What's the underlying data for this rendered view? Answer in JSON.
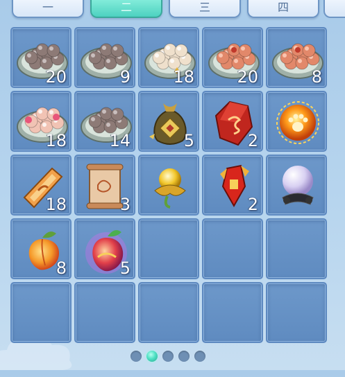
{
  "tabs": [
    {
      "label": "一",
      "active": false
    },
    {
      "label": "二",
      "active": true
    },
    {
      "label": "三",
      "active": false
    },
    {
      "label": "四",
      "active": false
    }
  ],
  "inventory": {
    "rows": [
      [
        {
          "icon": "dumpling-plate-gray",
          "count": "20"
        },
        {
          "icon": "dumpling-plate-gray",
          "count": "9"
        },
        {
          "icon": "dumpling-plate-white",
          "count": "18"
        },
        {
          "icon": "dumpling-plate-red",
          "count": "20"
        },
        {
          "icon": "dumpling-plate-red",
          "count": "8"
        }
      ],
      [
        {
          "icon": "dumpling-plate-pink",
          "count": "18"
        },
        {
          "icon": "dumpling-plate-gray",
          "count": "14"
        },
        {
          "icon": "lucky-bag-icon",
          "count": "5"
        },
        {
          "icon": "red-gem-icon",
          "count": "2"
        },
        {
          "icon": "paw-orb-icon",
          "count": ""
        }
      ],
      [
        {
          "icon": "scroll-orange-icon",
          "count": "18"
        },
        {
          "icon": "scroll-map-icon",
          "count": "3"
        },
        {
          "icon": "golden-bud-icon",
          "count": ""
        },
        {
          "icon": "red-ribbon-icon",
          "count": "2"
        },
        {
          "icon": "crystal-ball-icon",
          "count": ""
        }
      ],
      [
        {
          "icon": "peach-icon",
          "count": "8"
        },
        {
          "icon": "magic-peach-icon",
          "count": "5"
        },
        {
          "icon": "",
          "count": ""
        },
        {
          "icon": "",
          "count": ""
        },
        {
          "icon": "",
          "count": ""
        }
      ],
      [
        {
          "icon": "",
          "count": ""
        },
        {
          "icon": "",
          "count": ""
        },
        {
          "icon": "",
          "count": ""
        },
        {
          "icon": "",
          "count": ""
        },
        {
          "icon": "",
          "count": ""
        }
      ]
    ]
  },
  "pager": {
    "pages": 5,
    "current": 2
  },
  "colors": {
    "accent": "#4dd1c0",
    "slot": "#6290c4",
    "slot_border": "#5d89c0"
  }
}
